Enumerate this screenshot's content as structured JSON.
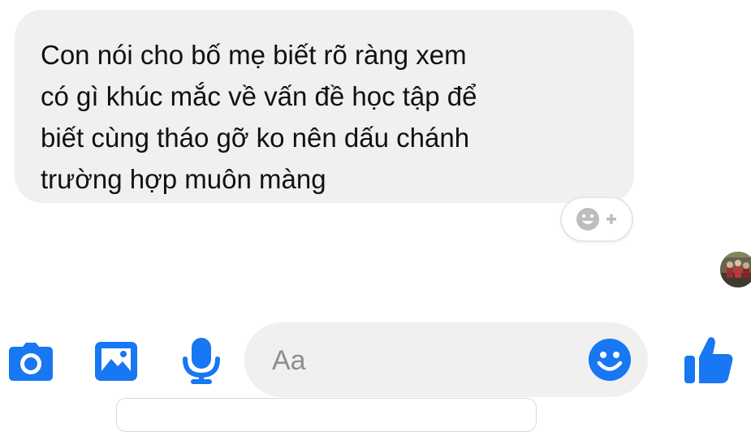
{
  "message": {
    "text": "Con nói cho bố mẹ biết rõ ràng xem\ncó gì khúc mắc về vấn đề học tập để\nbiết cùng tháo gỡ ko nên dấu chánh\ntrường hợp muôn màng"
  },
  "reaction_button": {
    "icon": "add-reaction-icon",
    "color": "#bdbdbd"
  },
  "composer": {
    "placeholder": "Aa"
  },
  "toolbar": {
    "camera_icon": "camera-icon",
    "gallery_icon": "image-icon",
    "mic_icon": "microphone-icon",
    "emoji_icon": "smiley-icon",
    "like_icon": "thumbs-up-icon"
  },
  "colors": {
    "accent": "#1877f2",
    "bubble": "#f0f0f0",
    "text": "#111111",
    "placeholder": "#8e8e8e"
  }
}
